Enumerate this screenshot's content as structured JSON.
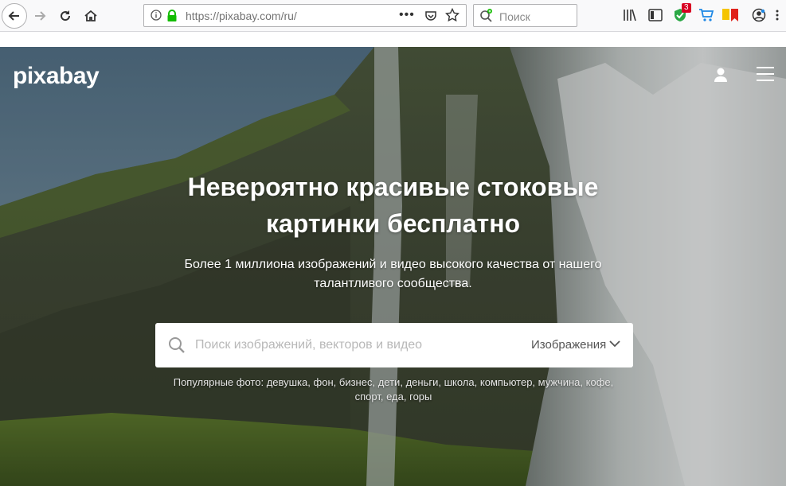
{
  "browser": {
    "url": "https://pixabay.com/ru/",
    "search_placeholder": "Поиск",
    "notification_badge": "3"
  },
  "site": {
    "logo": "pixabay",
    "headline_line1": "Невероятно красивые стоковые",
    "headline_line2": "картинки бесплатно",
    "subhead_line1": "Более 1 миллиона изображений и видео высокого качества от нашего",
    "subhead_line2": "талантливого сообщества.",
    "search_placeholder": "Поиск изображений, векторов и видео",
    "search_type": "Изображения",
    "popular_label": "Популярные фото:",
    "popular_tags": [
      "девушка",
      "фон",
      "бизнес",
      "дети",
      "деньги",
      "школа",
      "компьютер",
      "мужчина",
      "кофе",
      "спорт",
      "еда",
      "горы"
    ]
  },
  "colors": {
    "brand_white": "#ffffff",
    "badge_red": "#d70022",
    "lock_green": "#12bc00"
  }
}
